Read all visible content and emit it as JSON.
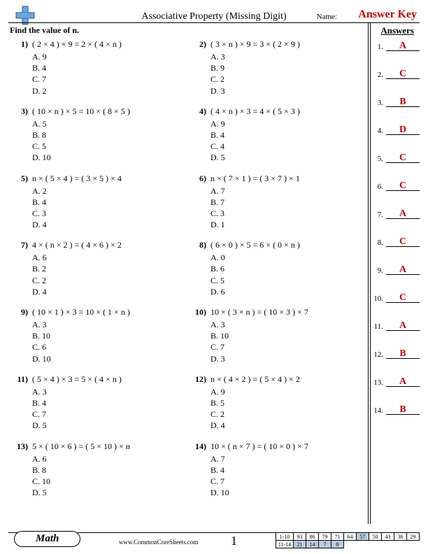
{
  "header": {
    "title": "Associative Property (Missing Digit)",
    "name_label": "Name:",
    "answer_key": "Answer Key",
    "answers_header": "Answers"
  },
  "instruction": "Find the value of n.",
  "problems": [
    {
      "num": "1)",
      "eq": "( 2 × 4 ) × 9 = 2 × ( 4 × n )",
      "opts": [
        "A. 9",
        "B. 4",
        "C. 7",
        "D. 2"
      ]
    },
    {
      "num": "2)",
      "eq": "( 3 × n ) × 9 = 3 × ( 2 × 9 )",
      "opts": [
        "A. 3",
        "B. 9",
        "C. 2",
        "D. 3"
      ]
    },
    {
      "num": "3)",
      "eq": "( 10 × n ) × 5 = 10 × ( 8 × 5 )",
      "opts": [
        "A. 5",
        "B. 8",
        "C. 5",
        "D. 10"
      ]
    },
    {
      "num": "4)",
      "eq": "( 4 × n ) × 3 = 4 × ( 5 × 3 )",
      "opts": [
        "A. 9",
        "B. 4",
        "C. 4",
        "D. 5"
      ]
    },
    {
      "num": "5)",
      "eq": "n × ( 5 × 4 ) = ( 3 × 5 ) × 4",
      "opts": [
        "A. 2",
        "B. 4",
        "C. 3",
        "D. 4"
      ]
    },
    {
      "num": "6)",
      "eq": "n × ( 7 × 1 ) = ( 3 × 7 ) × 1",
      "opts": [
        "A. 7",
        "B. 7",
        "C. 3",
        "D. 1"
      ]
    },
    {
      "num": "7)",
      "eq": "4 × ( n × 2 ) = ( 4 × 6 ) × 2",
      "opts": [
        "A. 6",
        "B. 2",
        "C. 2",
        "D. 4"
      ]
    },
    {
      "num": "8)",
      "eq": "( 6 × 0 ) × 5 = 6 × ( 0 × n )",
      "opts": [
        "A. 0",
        "B. 6",
        "C. 5",
        "D. 6"
      ]
    },
    {
      "num": "9)",
      "eq": "( 10 × 1 ) × 3 = 10 × ( 1 × n )",
      "opts": [
        "A. 3",
        "B. 10",
        "C. 6",
        "D. 10"
      ]
    },
    {
      "num": "10)",
      "eq": "10 × ( 3 × n ) = ( 10 × 3 ) × 7",
      "opts": [
        "A. 3",
        "B. 10",
        "C. 7",
        "D. 3"
      ]
    },
    {
      "num": "11)",
      "eq": "( 5 × 4 ) × 3 = 5 × ( 4 × n )",
      "opts": [
        "A. 3",
        "B. 4",
        "C. 7",
        "D. 5"
      ]
    },
    {
      "num": "12)",
      "eq": "n × ( 4 × 2 ) = ( 5 × 4 ) × 2",
      "opts": [
        "A. 9",
        "B. 5",
        "C. 2",
        "D. 4"
      ]
    },
    {
      "num": "13)",
      "eq": "5 × ( 10 × 6 ) = ( 5 × 10 ) × n",
      "opts": [
        "A. 6",
        "B. 8",
        "C. 10",
        "D. 5"
      ]
    },
    {
      "num": "14)",
      "eq": "10 × ( n × 7 ) = ( 10 × 0 ) × 7",
      "opts": [
        "A. 7",
        "B. 4",
        "C. 7",
        "D. 10"
      ]
    }
  ],
  "answers": [
    {
      "n": "1.",
      "v": "A"
    },
    {
      "n": "2.",
      "v": "C"
    },
    {
      "n": "3.",
      "v": "B"
    },
    {
      "n": "4.",
      "v": "D"
    },
    {
      "n": "5.",
      "v": "C"
    },
    {
      "n": "6.",
      "v": "C"
    },
    {
      "n": "7.",
      "v": "A"
    },
    {
      "n": "8.",
      "v": "C"
    },
    {
      "n": "9.",
      "v": "A"
    },
    {
      "n": "10.",
      "v": "C"
    },
    {
      "n": "11.",
      "v": "A"
    },
    {
      "n": "12.",
      "v": "B"
    },
    {
      "n": "13.",
      "v": "A"
    },
    {
      "n": "14.",
      "v": "B"
    }
  ],
  "footer": {
    "subject": "Math",
    "site": "www.CommonCoreSheets.com",
    "page": "1",
    "score": {
      "row1_label": "1-10",
      "row2_label": "11-14",
      "row1": [
        "93",
        "86",
        "79",
        "71",
        "64",
        "57",
        "50",
        "43",
        "36",
        "29"
      ],
      "row2": [
        "21",
        "14",
        "7",
        "0",
        "",
        "",
        "",
        "",
        "",
        ""
      ]
    }
  }
}
